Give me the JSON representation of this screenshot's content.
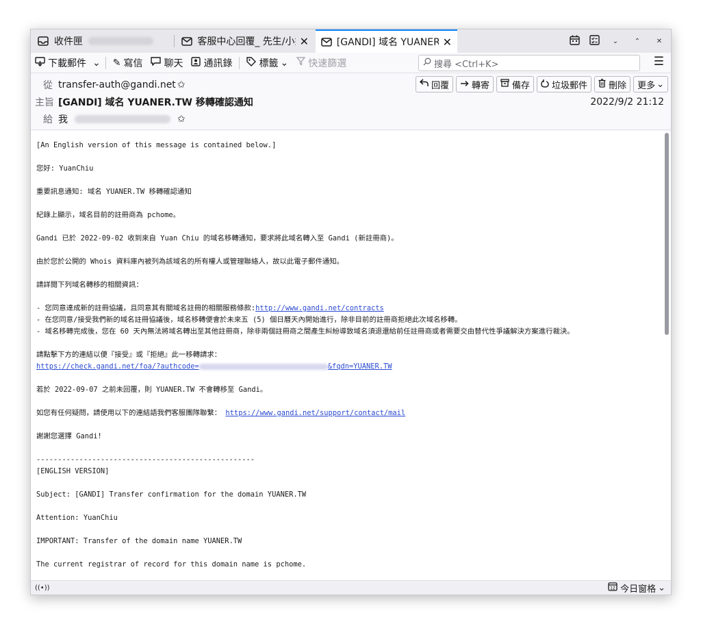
{
  "tabs": [
    {
      "label": "收件匣",
      "icon": "inbox-icon"
    },
    {
      "label": "客服中心回覆_ 先生/小姐",
      "icon": "envelope-icon"
    },
    {
      "label": "[GANDI] 域名 YUANER.TW",
      "icon": "envelope-icon"
    }
  ],
  "toolbar": {
    "download": "下載郵件",
    "write": "寫信",
    "chat": "聊天",
    "addressbook": "通訊錄",
    "tags": "標籤",
    "quickfilter": "快速篩選",
    "search_placeholder": "搜尋 <Ctrl+K>"
  },
  "header": {
    "from_label": "從",
    "from": "transfer-auth@gandi.net",
    "subject_label": "主旨",
    "subject": "[GANDI] 域名 YUANER.TW 移轉確認通知",
    "to_label": "給",
    "to": "我",
    "date": "2022/9/2 21:12",
    "actions": {
      "reply": "回覆",
      "forward": "轉寄",
      "archive": "備存",
      "junk": "垃圾郵件",
      "delete": "刪除",
      "more": "更多"
    }
  },
  "body": {
    "l1": "[An English version of this message is contained below.]",
    "l2": "您好: YuanChiu",
    "l3": "重要訊息通知: 域名 YUANER.TW 移轉確認通知",
    "l4": "紀錄上顯示，域名目前的註冊商為 pchome。",
    "l5": "Gandi 已於 2022-09-02 收到來自 Yuan Chiu 的域名移轉通知，要求將此域名轉入至 Gandi (新註冊商)。",
    "l6": "由於您於公開的 Whois 資料庫內被列為該域名的所有權人或管理聯絡人，故以此電子郵件通知。",
    "l7": "請詳閱下列域名轉移的相關資訊：",
    "l8a": "- 您同意達成新的註冊協議，且同意其有關域名註冊的相關服務條款:",
    "l8link": "http://www.gandi.net/contracts",
    "l9": "- 在您同意/接受我們新的域名註冊協議後，域名移轉便會於未來五 (5) 個日曆天內開始進行，除非目前的註冊商拒絕此次域名移轉。",
    "l10": "- 域名移轉完成後，您在 60 天內無法將域名轉出至其他註冊商，除非兩個註冊商之間產生糾紛導致域名須退還給前任註冊商或者需要交由替代性爭議解決方案進行裁決。",
    "l11": "請點擊下方的連結以便『接受』或『拒絕』此一移轉請求：",
    "l12a": "https://check.gandi.net/foa/?authcode=",
    "l12b": "&fqdn=YUANER.TW",
    "l13": "若於 2022-09-07 之前未回覆，則 YUANER.TW 不會轉移至 Gandi。",
    "l14a": "如您有任何疑問，請使用以下的連結語我們客服團隊聯繫： ",
    "l14link": "https://www.gandi.net/support/contact/mail",
    "l15": "謝謝您選擇 Gandi!",
    "l16": "---------------------------------------------------",
    "l17": "[ENGLISH VERSION]",
    "l18": "Subject: [GANDI] Transfer confirmation for the domain YUANER.TW",
    "l19": "Attention: YuanChiu",
    "l20": "IMPORTANT: Transfer of the domain name YUANER.TW",
    "l21": "The current registrar of record for this domain name is pchome."
  },
  "status": {
    "today": "今日窗格"
  }
}
